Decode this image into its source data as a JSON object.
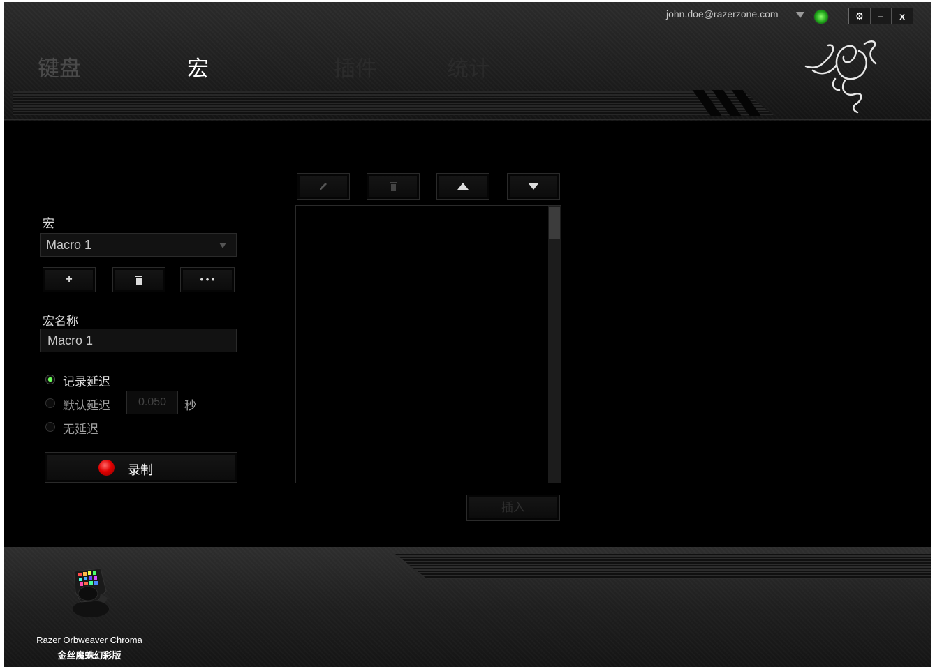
{
  "header": {
    "tabs": [
      {
        "label": "键盘",
        "state": "inactive"
      },
      {
        "label": "宏",
        "state": "active"
      },
      {
        "label": "插件",
        "state": "dim"
      },
      {
        "label": "统计",
        "state": "dim"
      }
    ],
    "account_email": "john.doe@razerzone.com",
    "window_buttons": {
      "settings": "⚙",
      "minimize": "–",
      "close": "x"
    }
  },
  "macro_panel": {
    "macro_label": "宏",
    "macro_select_value": "Macro 1",
    "add_button": "+",
    "delete_button_icon": "trash-icon",
    "more_button": "• • •",
    "name_label": "宏名称",
    "name_value": "Macro 1",
    "delay_options": [
      {
        "label": "记录延迟",
        "selected": true
      },
      {
        "label": "默认延迟",
        "selected": false
      },
      {
        "label": "无延迟",
        "selected": false
      }
    ],
    "default_delay_value": "0.050",
    "delay_unit": "秒",
    "record_label": "录制"
  },
  "event_panel": {
    "toolbar_icons": [
      "pencil-icon",
      "trash-icon",
      "arrow-up-icon",
      "arrow-down-icon"
    ],
    "insert_label": "插入"
  },
  "footer": {
    "device_name": "Razer Orbweaver Chroma",
    "device_subtitle": "金丝魔蛛幻彩版"
  },
  "colors": {
    "accent_green": "#44d62c",
    "record_red": "#e00000"
  }
}
